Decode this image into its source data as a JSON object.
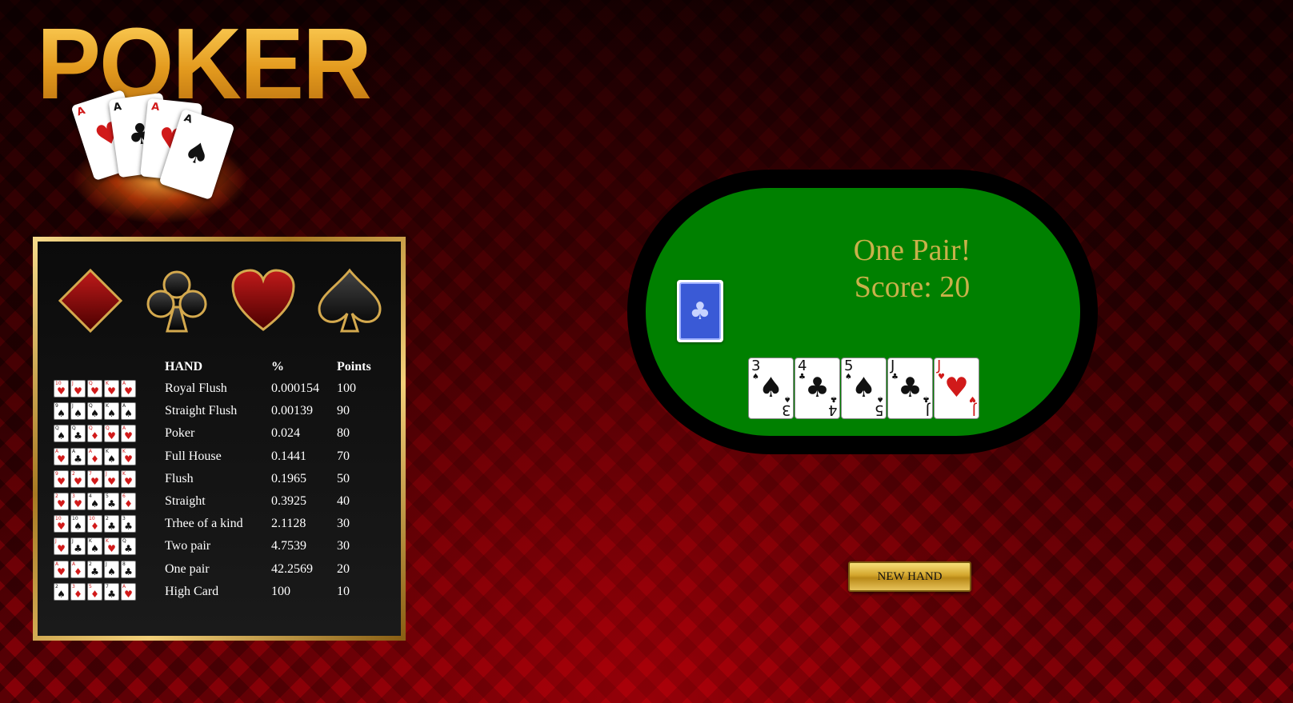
{
  "logo": {
    "text": "POKER",
    "cards": [
      {
        "rank": "A",
        "suit": "♥"
      },
      {
        "rank": "A",
        "suit": "♣"
      },
      {
        "rank": "A",
        "suit": "♥"
      },
      {
        "rank": "A",
        "suit": "♠"
      }
    ]
  },
  "colors": {
    "felt": "#008000",
    "gold": "#c9a04a",
    "result_text": "#c9b14a"
  },
  "suits": [
    "diamond-icon",
    "club-icon",
    "heart-icon",
    "spade-icon"
  ],
  "paytable": {
    "headers": {
      "hand": "HAND",
      "percent": "%",
      "points": "Points"
    },
    "rows": [
      {
        "hand": "Royal Flush",
        "percent": "0.000154",
        "points": "100",
        "cards": [
          [
            "10",
            "♥"
          ],
          [
            "J",
            "♥"
          ],
          [
            "Q",
            "♥"
          ],
          [
            "K",
            "♥"
          ],
          [
            "A",
            "♥"
          ]
        ]
      },
      {
        "hand": "Straight Flush",
        "percent": "0.00139",
        "points": "90",
        "cards": [
          [
            "9",
            "♠"
          ],
          [
            "J",
            "♠"
          ],
          [
            "Q",
            "♠"
          ],
          [
            "K",
            "♠"
          ],
          [
            "A",
            "♠"
          ]
        ]
      },
      {
        "hand": "Poker",
        "percent": "0.024",
        "points": "80",
        "cards": [
          [
            "Q",
            "♠"
          ],
          [
            "Q",
            "♣"
          ],
          [
            "Q",
            "♦"
          ],
          [
            "Q",
            "♥"
          ],
          [
            "A",
            "♥"
          ]
        ]
      },
      {
        "hand": "Full House",
        "percent": "0.1441",
        "points": "70",
        "cards": [
          [
            "A",
            "♥"
          ],
          [
            "A",
            "♣"
          ],
          [
            "A",
            "♦"
          ],
          [
            "K",
            "♠"
          ],
          [
            "K",
            "♥"
          ]
        ]
      },
      {
        "hand": "Flush",
        "percent": "0.1965",
        "points": "50",
        "cards": [
          [
            "9",
            "♥"
          ],
          [
            "2",
            "♥"
          ],
          [
            "7",
            "♥"
          ],
          [
            "J",
            "♥"
          ],
          [
            "K",
            "♥"
          ]
        ]
      },
      {
        "hand": "Straight",
        "percent": "0.3925",
        "points": "40",
        "cards": [
          [
            "2",
            "♥"
          ],
          [
            "3",
            "♥"
          ],
          [
            "4",
            "♠"
          ],
          [
            "5",
            "♣"
          ],
          [
            "6",
            "♦"
          ]
        ]
      },
      {
        "hand": "Trhee of a kind",
        "percent": "2.1128",
        "points": "30",
        "cards": [
          [
            "10",
            "♥"
          ],
          [
            "10",
            "♠"
          ],
          [
            "10",
            "♦"
          ],
          [
            "2",
            "♣"
          ],
          [
            "3",
            "♣"
          ]
        ]
      },
      {
        "hand": "Two pair",
        "percent": "4.7539",
        "points": "30",
        "cards": [
          [
            "J",
            "♥"
          ],
          [
            "J",
            "♣"
          ],
          [
            "K",
            "♠"
          ],
          [
            "K",
            "♥"
          ],
          [
            "Q",
            "♣"
          ]
        ]
      },
      {
        "hand": "One pair",
        "percent": "42.2569",
        "points": "20",
        "cards": [
          [
            "A",
            "♥"
          ],
          [
            "A",
            "♦"
          ],
          [
            "2",
            "♣"
          ],
          [
            "J",
            "♠"
          ],
          [
            "8",
            "♣"
          ]
        ]
      },
      {
        "hand": "High Card",
        "percent": "100",
        "points": "10",
        "cards": [
          [
            "2",
            "♠"
          ],
          [
            "3",
            "♦"
          ],
          [
            "5",
            "♦"
          ],
          [
            "7",
            "♣"
          ],
          [
            "A",
            "♥"
          ]
        ]
      }
    ]
  },
  "result": {
    "line1": "One Pair!",
    "line2": "Score: 20"
  },
  "deck": {
    "back_symbol": "♣"
  },
  "hand": [
    {
      "rank": "3",
      "suit": "♠"
    },
    {
      "rank": "4",
      "suit": "♣"
    },
    {
      "rank": "5",
      "suit": "♠"
    },
    {
      "rank": "J",
      "suit": "♣"
    },
    {
      "rank": "J",
      "suit": "♥"
    }
  ],
  "buttons": {
    "new_hand": "NEW HAND"
  }
}
